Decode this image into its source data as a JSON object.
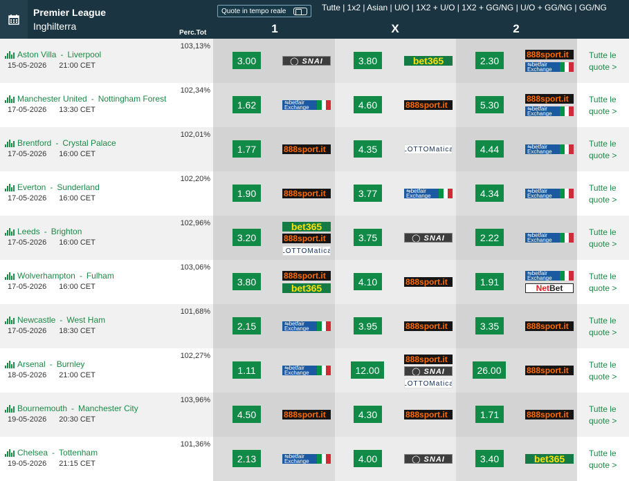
{
  "header": {
    "league": "Premier League",
    "country": "Inghilterra",
    "live_label": "Quote in tempo reale",
    "markets": "Tutte | 1x2 | Asian | U/O | 1X2 + U/O | 1X2 + GG/NG | U/O + GG/NG | GG/NG",
    "perc_label": "Perc.Tot",
    "col1": "1",
    "colx": "X",
    "col2": "2"
  },
  "more_label_1": "Tutte le",
  "more_label_2": "quote >",
  "colors": {
    "header": "#1a3441",
    "accent": "#118a47",
    "link": "#1c8a46"
  },
  "matches": [
    {
      "home": "Aston Villa",
      "away": "Liverpool",
      "date": "15-05-2026",
      "time": "21:00 CET",
      "perc": "103,13%",
      "o1": "3.00",
      "ox": "3.80",
      "o2": "2.30",
      "b1": [
        "snai"
      ],
      "bx": [
        "bet365"
      ],
      "b2": [
        "888",
        "betfair"
      ]
    },
    {
      "home": "Manchester United",
      "away": "Nottingham Forest",
      "date": "17-05-2026",
      "time": "13:30 CET",
      "perc": "102,34%",
      "o1": "1.62",
      "ox": "4.60",
      "o2": "5.30",
      "b1": [
        "betfair"
      ],
      "bx": [
        "888"
      ],
      "b2": [
        "888",
        "betfair"
      ]
    },
    {
      "home": "Brentford",
      "away": "Crystal Palace",
      "date": "17-05-2026",
      "time": "16:00 CET",
      "perc": "102,01%",
      "o1": "1.77",
      "ox": "4.35",
      "o2": "4.44",
      "b1": [
        "888"
      ],
      "bx": [
        "lotto"
      ],
      "b2": [
        "betfair"
      ]
    },
    {
      "home": "Everton",
      "away": "Sunderland",
      "date": "17-05-2026",
      "time": "16:00 CET",
      "perc": "102,20%",
      "o1": "1.90",
      "ox": "3.77",
      "o2": "4.34",
      "b1": [
        "888"
      ],
      "bx": [
        "betfair"
      ],
      "b2": [
        "betfair"
      ]
    },
    {
      "home": "Leeds",
      "away": "Brighton",
      "date": "17-05-2026",
      "time": "16:00 CET",
      "perc": "102,96%",
      "o1": "3.20",
      "ox": "3.75",
      "o2": "2.22",
      "b1": [
        "bet365",
        "888",
        "lotto"
      ],
      "bx": [
        "snai"
      ],
      "b2": [
        "betfair"
      ]
    },
    {
      "home": "Wolverhampton",
      "away": "Fulham",
      "date": "17-05-2026",
      "time": "16:00 CET",
      "perc": "103,06%",
      "o1": "3.80",
      "ox": "4.10",
      "o2": "1.91",
      "b1": [
        "888",
        "bet365"
      ],
      "bx": [
        "888"
      ],
      "b2": [
        "betfair",
        "netbet"
      ]
    },
    {
      "home": "Newcastle",
      "away": "West Ham",
      "date": "17-05-2026",
      "time": "18:30 CET",
      "perc": "101,68%",
      "o1": "2.15",
      "ox": "3.95",
      "o2": "3.35",
      "b1": [
        "betfair"
      ],
      "bx": [
        "888"
      ],
      "b2": [
        "888"
      ]
    },
    {
      "home": "Arsenal",
      "away": "Burnley",
      "date": "18-05-2026",
      "time": "21:00 CET",
      "perc": "102,27%",
      "o1": "1.11",
      "ox": "12.00",
      "o2": "26.00",
      "b1": [
        "betfair"
      ],
      "bx": [
        "888",
        "snai",
        "lotto"
      ],
      "b2": [
        "888"
      ]
    },
    {
      "home": "Bournemouth",
      "away": "Manchester City",
      "date": "19-05-2026",
      "time": "20:30 CET",
      "perc": "103,96%",
      "o1": "4.50",
      "ox": "4.30",
      "o2": "1.71",
      "b1": [
        "888"
      ],
      "bx": [
        "888"
      ],
      "b2": [
        "888"
      ]
    },
    {
      "home": "Chelsea",
      "away": "Tottenham",
      "date": "19-05-2026",
      "time": "21:15 CET",
      "perc": "101,36%",
      "o1": "2.13",
      "ox": "4.00",
      "o2": "3.40",
      "b1": [
        "betfair"
      ],
      "bx": [
        "snai"
      ],
      "b2": [
        "bet365"
      ]
    }
  ],
  "bookmakers": {
    "snai": {
      "name": "SNAI",
      "icon": "snai-logo"
    },
    "bet365": {
      "name": "bet365",
      "icon": "bet365-logo"
    },
    "888": {
      "name": "888",
      "sub": "sport.it",
      "icon": "888sport-logo"
    },
    "betfair": {
      "name": "betfair",
      "sub": "Exchange",
      "icon": "betfair-exchange-logo"
    },
    "lotto": {
      "name": "LOTTOMatica",
      "icon": "lottomatica-logo"
    },
    "netbet": {
      "name": "Net",
      "sub": "Bet",
      "icon": "netbet-logo"
    }
  }
}
